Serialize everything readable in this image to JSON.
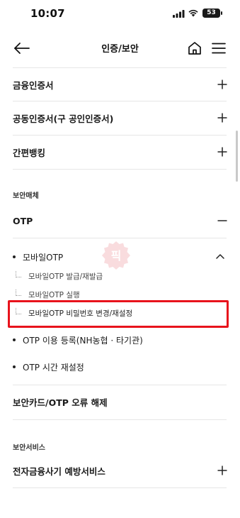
{
  "status": {
    "time": "10:07",
    "battery": "53"
  },
  "header": {
    "title": "인증/보안"
  },
  "menu": {
    "items_top": [
      {
        "label": "금융인증서"
      },
      {
        "label": "공동인증서(구 공인인증서)"
      },
      {
        "label": "간편뱅킹"
      }
    ],
    "section_security_media": "보안매체",
    "otp": {
      "label": "OTP",
      "mobile_otp": {
        "label": "모바일OTP",
        "children": [
          "모바일OTP 발급/재발급",
          "모바일OTP 실행",
          "모바일OTP 비밀번호 변경/재설정"
        ]
      },
      "otp_register": "OTP 이용 등록(NH농협 · 타기관)",
      "otp_time_reset": "OTP 시간 재설정"
    },
    "security_card_error": "보안카드/OTP 오류 해제",
    "section_security_service": "보안서비스",
    "fraud_prevention": "전자금융사기 예방서비스"
  },
  "watermark": {
    "text": "픽"
  }
}
